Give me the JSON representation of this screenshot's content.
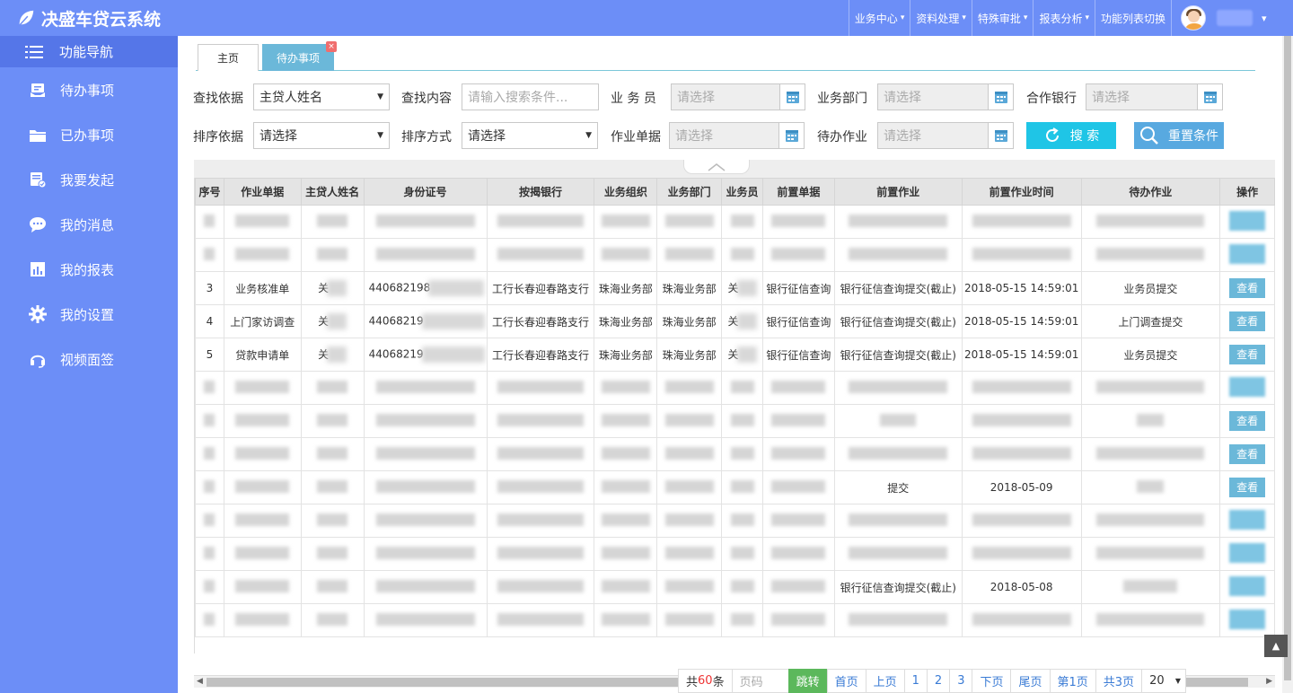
{
  "app": {
    "title": "决盛车贷云系统"
  },
  "topnav": [
    {
      "label": "业务中心",
      "caret": "▾"
    },
    {
      "label": "资料处理",
      "caret": "▾"
    },
    {
      "label": "特殊审批",
      "caret": "▾"
    },
    {
      "label": "报表分析",
      "caret": "▾"
    },
    {
      "label": "功能列表切换",
      "caret": ""
    }
  ],
  "user": {
    "caret": "▾"
  },
  "sidebar": {
    "header": "功能导航",
    "items": [
      {
        "label": "待办事项",
        "icon": "inbox-icon"
      },
      {
        "label": "已办事项",
        "icon": "folder-icon"
      },
      {
        "label": "我要发起",
        "icon": "initiate-icon"
      },
      {
        "label": "我的消息",
        "icon": "chat-icon"
      },
      {
        "label": "我的报表",
        "icon": "report-icon"
      },
      {
        "label": "我的设置",
        "icon": "gear-icon"
      },
      {
        "label": "视频面签",
        "icon": "headset-icon"
      }
    ]
  },
  "tabs": [
    {
      "label": "主页",
      "active": false
    },
    {
      "label": "待办事项",
      "active": true,
      "close": "×"
    }
  ],
  "filters": {
    "search_by_label": "查找依据",
    "search_by_value": "主贷人姓名",
    "search_content_label": "查找内容",
    "search_content_placeholder": "请输入搜索条件...",
    "salesman_label": "业 务 员",
    "dept_label": "业务部门",
    "bank_label": "合作银行",
    "sort_by_label": "排序依据",
    "sort_mode_label": "排序方式",
    "doc_label": "作业单据",
    "pending_label": "待办作业",
    "please_select": "请选择",
    "search_button": "搜 索",
    "reset_button": "重置条件"
  },
  "table": {
    "columns": [
      "序号",
      "作业单据",
      "主贷人姓名",
      "身份证号",
      "按揭银行",
      "业务组织",
      "业务部门",
      "业务员",
      "前置单据",
      "前置作业",
      "前置作业时间",
      "待办作业",
      "操作"
    ],
    "rows": [
      {
        "no": "3",
        "doc": "业务核准单",
        "name": "关",
        "id": "440682198",
        "bank": "工行长春迎春路支行",
        "org": "珠海业务部",
        "dept": "珠海业务部",
        "salesman": "关",
        "pre_doc": "银行征信查询",
        "pre_job": "银行征信查询提交(截止)",
        "pre_time": "2018-05-15 14:59:01",
        "pending": "业务员提交",
        "action": "查看"
      },
      {
        "no": "4",
        "doc": "上门家访调查",
        "name": "关",
        "id": "44068219",
        "bank": "工行长春迎春路支行",
        "org": "珠海业务部",
        "dept": "珠海业务部",
        "salesman": "关",
        "pre_doc": "银行征信查询",
        "pre_job": "银行征信查询提交(截止)",
        "pre_time": "2018-05-15 14:59:01",
        "pending": "上门调查提交",
        "action": "查看"
      },
      {
        "no": "5",
        "doc": "贷款申请单",
        "name": "关",
        "id": "44068219",
        "bank": "工行长春迎春路支行",
        "org": "珠海业务部",
        "dept": "珠海业务部",
        "salesman": "关",
        "pre_doc": "银行征信查询",
        "pre_job": "银行征信查询提交(截止)",
        "pre_time": "2018-05-15 14:59:01",
        "pending": "业务员提交",
        "action": "查看"
      }
    ],
    "partial": {
      "row8_time": "2018-05-09",
      "row8_job": "提交",
      "row11_job": "银行征信查询提交(截止)",
      "row11_time": "2018-05-08",
      "view": "查看"
    }
  },
  "pager": {
    "total_prefix": "共",
    "total": "60",
    "total_suffix": "条",
    "page_input_placeholder": "页码",
    "jump": "跳转",
    "first": "首页",
    "prev": "上页",
    "pages": [
      "1",
      "2",
      "3"
    ],
    "next": "下页",
    "last": "尾页",
    "current": "第1页",
    "page_count": "共3页",
    "page_size": "20"
  }
}
